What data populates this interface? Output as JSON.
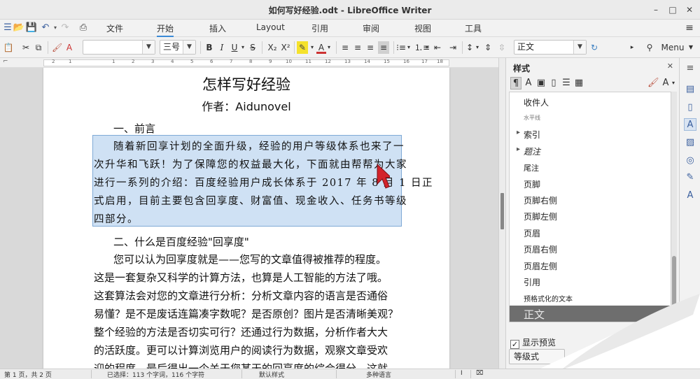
{
  "window": {
    "title": "如何写好经验.odt - LibreOffice Writer",
    "minimize": "–",
    "maximize": "□",
    "close": "✕"
  },
  "tabs": [
    "文件",
    "开始",
    "插入",
    "Layout",
    "引用",
    "审阅",
    "视图",
    "工具"
  ],
  "active_tab": "开始",
  "toolbar": {
    "font_name_value": "",
    "font_size_value": "三号",
    "bold": "B",
    "italic": "I",
    "underline": "U",
    "strikethrough": "S",
    "subscript": "X₂",
    "superscript": "X²",
    "paragraph_style_value": "正文",
    "menu_label": "Menu"
  },
  "document": {
    "title": "怎样写好经验",
    "author": "作者：Aidunovel",
    "heading1": "一、前言",
    "selected_lines": [
      "随着新回享计划的全面升级，经验的用户等级体系也来了一",
      "次升华和飞跃！为了保障您的权益最大化，下面就由帮帮为大家",
      "进行一系列的介绍：百度经验用户成长体系于 2017 年 8 月 1 日正",
      "式启用，目前主要包含回享度、财富值、现金收入、任务书等级",
      "四部分。"
    ],
    "heading2": "二、什么是百度经验\"回享度\"",
    "body_lines": [
      "您可以认为回享度就是——您写的文章值得被推荐的程度。",
      "这是一套复杂又科学的计算方法，也算是人工智能的方法了哦。",
      "这套算法会对您的文章进行分析：分析文章内容的语言是否通俗",
      "易懂？是不是废话连篇凑字数呢？是否原创？图片是否清晰美观？",
      "整个经验的方法是否切实可行？还通过行为数据，分析作者大大",
      "的活跃度。更可以计算浏览用户的阅读行为数据，观察文章受欢",
      "迎的程度。最后得出一个关于您某天的回享度的综合得分。这就"
    ]
  },
  "sidebar": {
    "title": "样式",
    "styles": [
      {
        "label": "收件人",
        "kind": "plain"
      },
      {
        "label": "水平线",
        "kind": "small"
      },
      {
        "label": "索引",
        "kind": "expandable"
      },
      {
        "label": "题注",
        "kind": "expandable-italic"
      },
      {
        "label": "尾注",
        "kind": "plain"
      },
      {
        "label": "页脚",
        "kind": "plain"
      },
      {
        "label": "页脚右侧",
        "kind": "plain"
      },
      {
        "label": "页脚左侧",
        "kind": "plain"
      },
      {
        "label": "页眉",
        "kind": "plain"
      },
      {
        "label": "页眉右侧",
        "kind": "plain"
      },
      {
        "label": "页眉左侧",
        "kind": "plain"
      },
      {
        "label": "引用",
        "kind": "plain"
      },
      {
        "label": "预格式化的文本",
        "kind": "plain"
      },
      {
        "label": "正文",
        "kind": "selected"
      }
    ],
    "show_preview_label": "显示预览",
    "hierarchy_button": "等级式"
  },
  "statusbar": {
    "page": "第 1 页，共 2 页",
    "selection": "已选择：113 个字词，116 个字符",
    "page_style": "默认样式",
    "language": "多种语言"
  }
}
